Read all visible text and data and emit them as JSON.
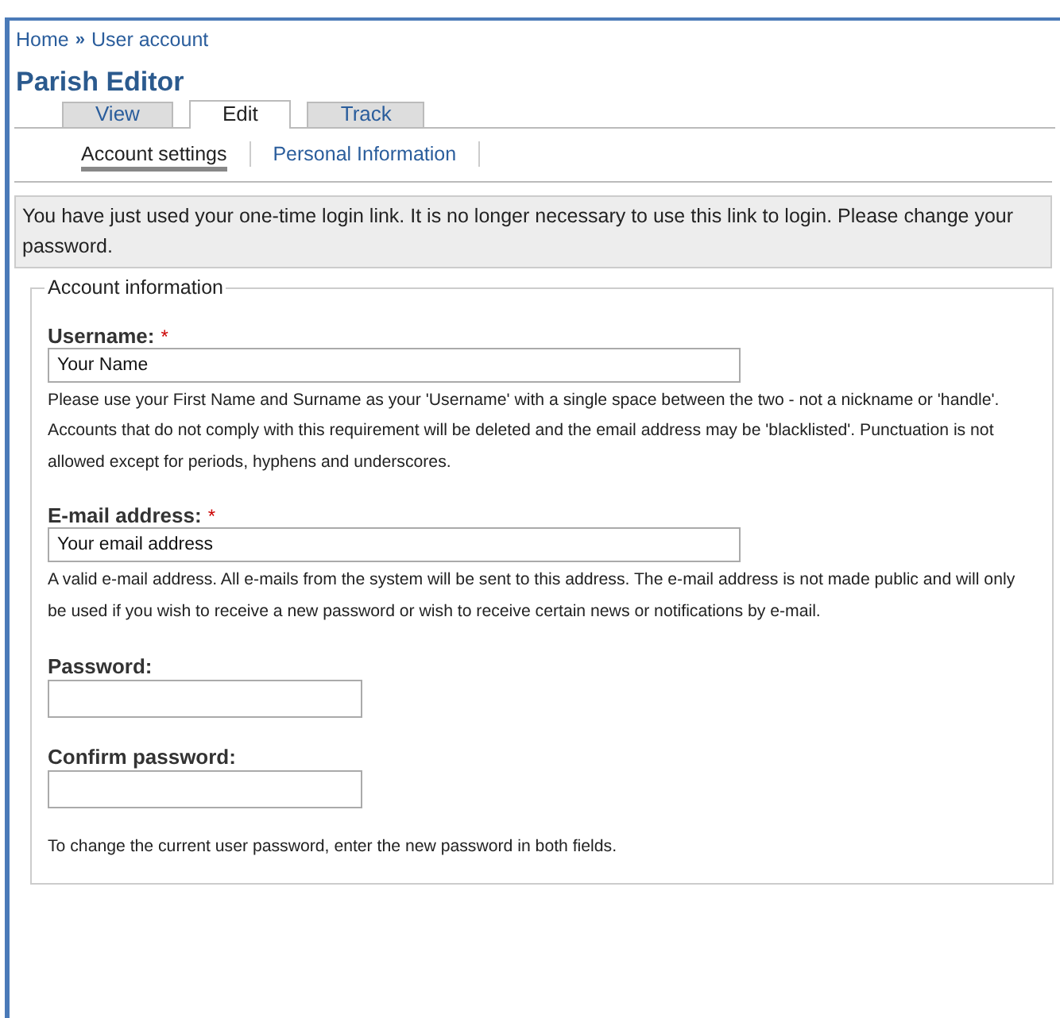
{
  "breadcrumb": {
    "items": [
      "Home",
      "User account"
    ],
    "separator": "»"
  },
  "title": "Parish Editor",
  "tabs": [
    {
      "label": "View",
      "selected": false
    },
    {
      "label": "Edit",
      "selected": true
    },
    {
      "label": "Track",
      "selected": false
    }
  ],
  "subtabs": [
    {
      "label": "Account settings",
      "selected": true
    },
    {
      "label": "Personal Information",
      "selected": false
    }
  ],
  "message": "You have just used your one-time login link. It is no longer necessary to use this link to login. Please change your password.",
  "fieldset": {
    "legend": "Account information",
    "fields": [
      {
        "label": "Username:",
        "required_mark": "*",
        "value": "Your Name",
        "description": "Please use your First Name and Surname as your 'Username' with a single space between the two - not a nickname or 'handle'. Accounts that do not comply with this requirement will be deleted and the email address may be 'blacklisted'. Punctuation is not allowed except for periods, hyphens and underscores.",
        "kind": "text"
      },
      {
        "label": "E-mail address:",
        "required_mark": "*",
        "value": "Your email address",
        "description": "A valid e-mail address. All e-mails from the system will be sent to this address. The e-mail address is not made public and will only be used if you wish to receive a new password or wish to receive certain news or notifications by e-mail.",
        "kind": "text"
      },
      {
        "label": "Password:",
        "kind": "password"
      },
      {
        "label": "Confirm password:",
        "kind": "password"
      }
    ],
    "description": "To change the current user password, enter the new password in both fields."
  }
}
